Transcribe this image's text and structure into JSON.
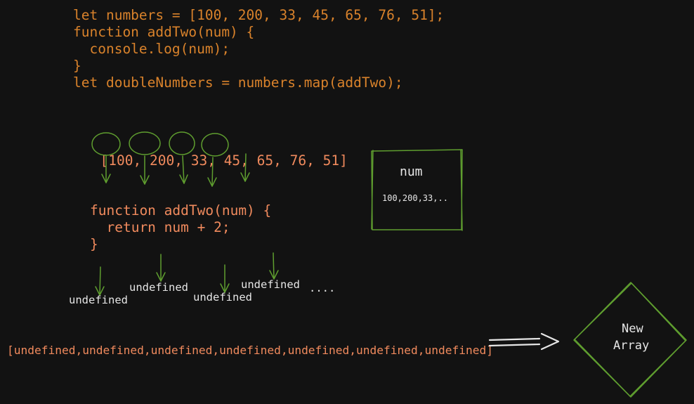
{
  "code": {
    "lines": [
      "let numbers = [100, 200, 33, 45, 65, 76, 51];",
      "function addTwo(num) {",
      "  console.log(num);",
      "}",
      "let doubleNumbers = numbers.map(addTwo);"
    ]
  },
  "array_input": {
    "open_bracket": "[",
    "items": [
      "100",
      "200",
      "33",
      "45",
      "65",
      "76",
      "51"
    ],
    "close_bracket": "]",
    "separator": ",",
    "circled_count": 4
  },
  "num_box": {
    "title": "num",
    "values": "100,200,33,.."
  },
  "function_block": {
    "lines": [
      "function addTwo(num) {",
      "  return num + 2;",
      "}"
    ]
  },
  "outputs": {
    "labels": [
      "undefined",
      "undefined",
      "undefined",
      "undefined"
    ],
    "ellipsis": "...."
  },
  "result_array": "[undefined,undefined,undefined,undefined,undefined,undefined,undefined]",
  "new_array": {
    "line1": "New",
    "line2": "Array"
  },
  "colors": {
    "background": "#121212",
    "code_orange": "#d9822b",
    "salmon": "#f08a5d",
    "green": "#5f9e2f",
    "white": "#e6e6e6"
  }
}
